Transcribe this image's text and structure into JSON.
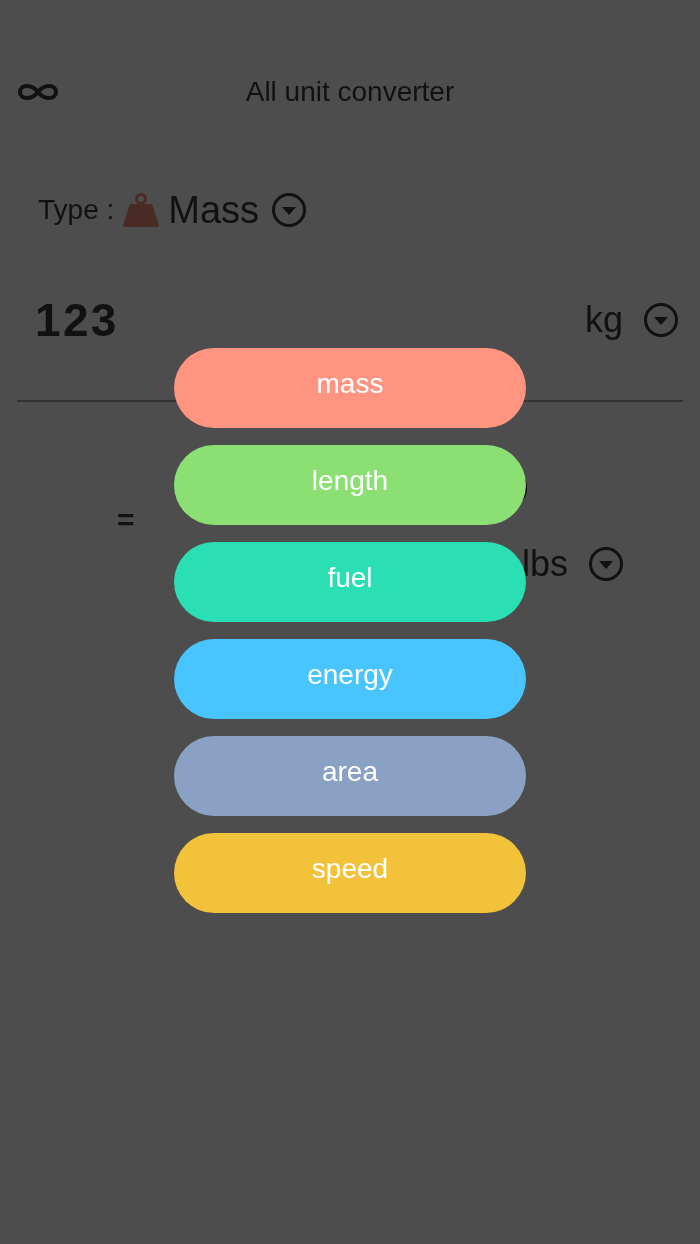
{
  "app_bar": {
    "title": "All unit converter"
  },
  "type_selector": {
    "label": "Type :",
    "value": "Mass"
  },
  "input": {
    "value": "123",
    "unit": "kg"
  },
  "result": {
    "equals": "=",
    "unit": "lbs"
  },
  "type_menu": [
    {
      "label": "mass",
      "color": "#ff9580"
    },
    {
      "label": "length",
      "color": "#8cdf73"
    },
    {
      "label": "fuel",
      "color": "#2adfb4"
    },
    {
      "label": "energy",
      "color": "#48c4fe"
    },
    {
      "label": "area",
      "color": "#8aa1c3"
    },
    {
      "label": "speed",
      "color": "#f3c23b"
    }
  ]
}
